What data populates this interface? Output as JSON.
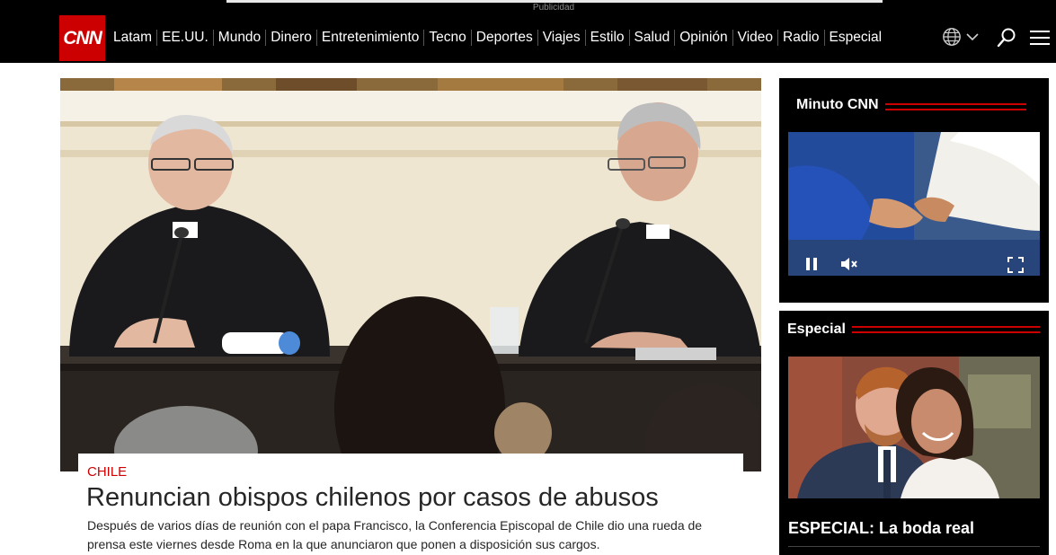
{
  "ad": {
    "label": "Publicidad"
  },
  "header": {
    "logo_text": "CNN",
    "nav": [
      "Latam",
      "EE.UU.",
      "Mundo",
      "Dinero",
      "Entretenimiento",
      "Tecno",
      "Deportes",
      "Viajes",
      "Estilo",
      "Salud",
      "Opinión",
      "Video",
      "Radio",
      "Especial"
    ],
    "icons": [
      "globe-icon",
      "chevron-down-icon",
      "search-icon",
      "hamburger-menu-icon"
    ]
  },
  "lead_story": {
    "kicker": "CHILE",
    "headline": "Renuncian obispos chilenos por casos de abusos",
    "dek": "Después de varios días de reunión con el papa Francisco, la Conferencia Episcopal de Chile dio una rueda de prensa este viernes desde Roma en la que anunciaron que ponen a disposición sus cargos."
  },
  "minuto_cnn": {
    "title": "Minuto CNN",
    "controls": [
      "pause-icon",
      "mute-icon",
      "fullscreen-icon"
    ]
  },
  "especial": {
    "title": "Especial",
    "story_title": "ESPECIAL: La boda real"
  },
  "colors": {
    "brand_red": "#cc0000",
    "header_bg": "#000000",
    "text": "#262626"
  }
}
